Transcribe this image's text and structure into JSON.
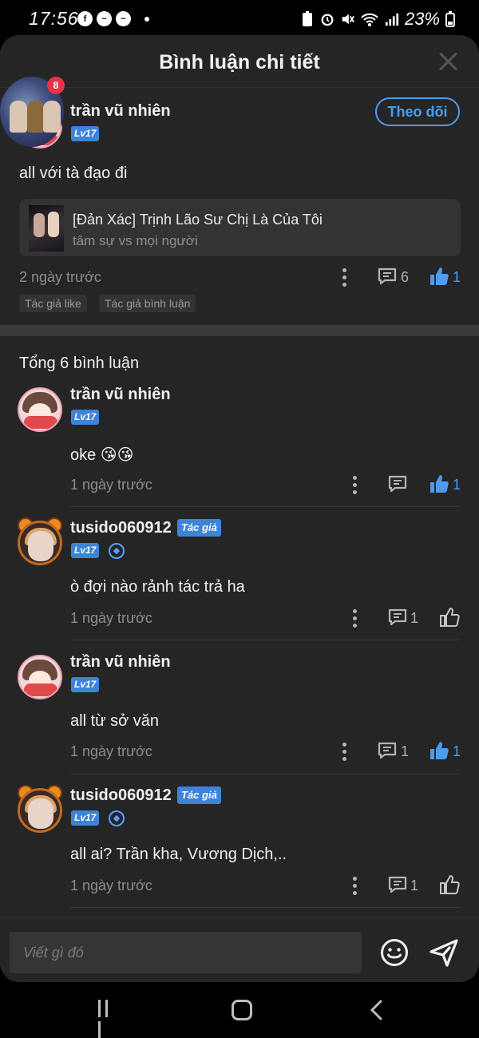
{
  "status_bar": {
    "time": "17:56",
    "battery": "23%"
  },
  "sheet": {
    "title": "Bình luận chi tiết",
    "notification_count": "8"
  },
  "main_comment": {
    "username": "trần vũ nhiên",
    "level": "Lv17",
    "follow_label": "Theo dõi",
    "text": "all với tà đạo đi",
    "story": {
      "title": "[Đản Xác] Trịnh Lão Sư Chị Là Của Tôi",
      "subtitle": "tâm sự vs mọi người"
    },
    "time": "2 ngày trước",
    "reply_count": "6",
    "like_count": "1",
    "tags": [
      "Tác giả like",
      "Tác giả bình luận"
    ]
  },
  "replies_header": "Tổng 6 bình luận",
  "replies": [
    {
      "username": "trần vũ nhiên",
      "level": "Lv17",
      "text": "oke 😘😘",
      "time": "1 ngày trước",
      "reply_count": "",
      "like_count": "1"
    },
    {
      "username": "tusido060912",
      "author_tag": "Tác giả",
      "level": "Lv17",
      "text": "ò đợi nào rảnh tác trả ha",
      "time": "1 ngày trước",
      "reply_count": "1",
      "like_count": ""
    },
    {
      "username": "trần vũ nhiên",
      "level": "Lv17",
      "text": "all từ sở văn",
      "time": "1 ngày trước",
      "reply_count": "1",
      "like_count": "1"
    },
    {
      "username": "tusido060912",
      "author_tag": "Tác giả",
      "level": "Lv17",
      "text": "all ai? Trần kha, Vương Dịch,..",
      "time": "1 ngày trước",
      "reply_count": "1",
      "like_count": ""
    }
  ],
  "input": {
    "placeholder": "Viết gì đó"
  },
  "colors": {
    "accent": "#4a9df0",
    "sheet_bg": "#252525",
    "level_badge": "#3d83d9"
  }
}
